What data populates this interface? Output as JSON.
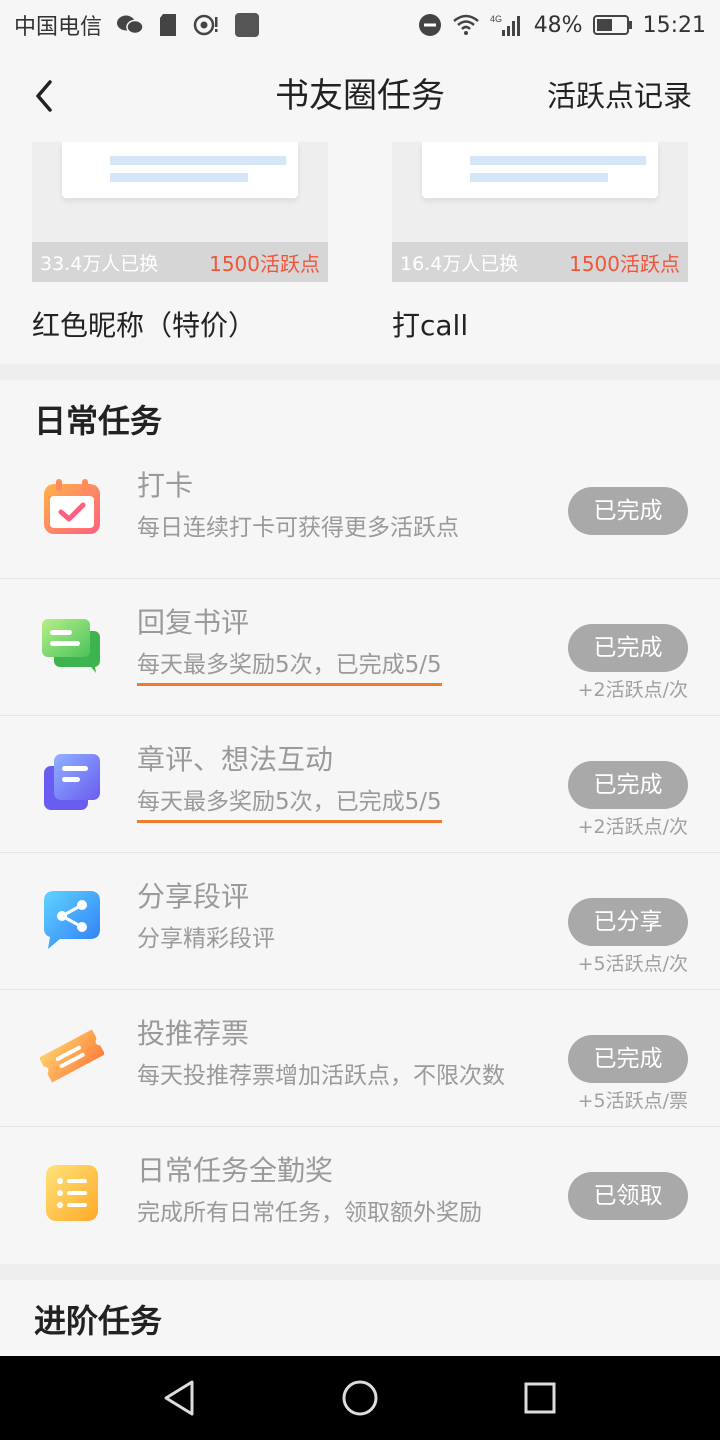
{
  "status_bar": {
    "carrier": "中国电信",
    "battery_percent": "48%",
    "time": "15:21",
    "network": "4G"
  },
  "nav": {
    "title": "书友圈任务",
    "action": "活跃点记录",
    "back_icon": "chevron-left-icon"
  },
  "rewards": [
    {
      "count_text": "33.4万人已换",
      "price": "1500活跃点",
      "name": "红色昵称（特价）"
    },
    {
      "count_text": "16.4万人已换",
      "price": "1500活跃点",
      "name": "打call"
    }
  ],
  "daily": {
    "title": "日常任务",
    "tasks": [
      {
        "icon": "calendar-check-icon",
        "title": "打卡",
        "desc": "每日连续打卡可获得更多活跃点",
        "button": "已完成",
        "reward": ""
      },
      {
        "icon": "chat-bubble-icon",
        "title": "回复书评",
        "desc": "每天最多奖励5次，已完成5/5",
        "button": "已完成",
        "reward": "+2活跃点/次"
      },
      {
        "icon": "document-stack-icon",
        "title": "章评、想法互动",
        "desc": "每天最多奖励5次，已完成5/5",
        "button": "已完成",
        "reward": "+2活跃点/次"
      },
      {
        "icon": "share-icon",
        "title": "分享段评",
        "desc": "分享精彩段评",
        "button": "已分享",
        "reward": "+5活跃点/次"
      },
      {
        "icon": "ticket-icon",
        "title": "投推荐票",
        "desc": "每天投推荐票增加活跃点，不限次数",
        "button": "已完成",
        "reward": "+5活跃点/票"
      },
      {
        "icon": "list-icon",
        "title": "日常任务全勤奖",
        "desc": "完成所有日常任务，领取额外奖励",
        "button": "已领取",
        "reward": ""
      }
    ]
  },
  "advanced": {
    "title": "进阶任务"
  },
  "colors": {
    "accent_orange": "#f07a2b",
    "price_red": "#f0553a",
    "button_gray": "#a9a9a9"
  }
}
